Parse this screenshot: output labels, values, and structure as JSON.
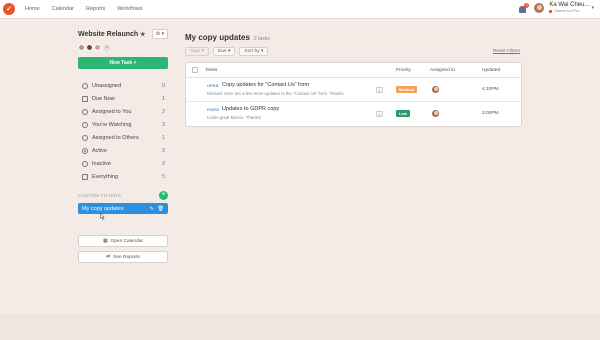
{
  "topbar": {
    "logo_glyph": "✓",
    "nav": [
      "Home",
      "Calendar",
      "Reports",
      "Workflows"
    ],
    "notification_count": "1",
    "user_name": "Ka Wai Cheu...",
    "user_role": "Owner for Pro...",
    "caret": "▾"
  },
  "sidebar": {
    "project_title": "Website Relaunch",
    "star": "★",
    "gear_label": "⚙ ▾",
    "add_member": "+",
    "new_task_label": "New Task +",
    "filters": [
      {
        "label": "Unassigned",
        "count": "0",
        "icon": "circle-outline-icon"
      },
      {
        "label": "Due Now",
        "count": "1",
        "icon": "calendar-icon"
      },
      {
        "label": "Assigned to You",
        "count": "2",
        "icon": "user-icon"
      },
      {
        "label": "You're Watching",
        "count": "3",
        "icon": "eye-icon"
      },
      {
        "label": "Assigned to Others",
        "count": "1",
        "icon": "users-icon"
      },
      {
        "label": "Active",
        "count": "3",
        "icon": "active-dot-icon"
      },
      {
        "label": "Inactive",
        "count": "2",
        "icon": "clock-icon"
      },
      {
        "label": "Everything",
        "count": "5",
        "icon": "stack-icon"
      }
    ],
    "custom_filters_label": "CUSTOM FILTERS",
    "custom_add": "+",
    "active_custom_filter": "My copy updates",
    "edit_glyph": "✎",
    "delete_glyph": "🗑",
    "open_calendar_label": "Open Calendar",
    "see_reports_label": "See Reports"
  },
  "main": {
    "title": "My copy updates",
    "subtitle": "2 tasks",
    "controls": {
      "tags": "Tags ▾",
      "due": "Due ▾",
      "sort": "Sort by ▾",
      "reset": "Reset Filters"
    },
    "columns": {
      "tasks": "Tasks",
      "priority": "Priority",
      "assigned": "Assigned to",
      "updated": "Updated"
    },
    "rows": [
      {
        "status": "OPEN",
        "name": "Copy updates for \"Contact Us\" form",
        "desc": "Michael: Here are a few more updates to the \"Contact Us\" form. Thanks",
        "comments": "1",
        "priority": "Medium",
        "priority_color": "#f5a25d",
        "updated": "4:10PM"
      },
      {
        "status": "FIXED",
        "name": "Updates to GDPR copy",
        "desc": "Looks great Marcie. Thanks!",
        "comments": "4",
        "priority": "Low",
        "priority_color": "#2a9d6a",
        "updated": "3:00PM"
      }
    ]
  },
  "colors": {
    "accent_green": "#2bb673",
    "accent_blue": "#2d8fdd",
    "brand_orange": "#e8542a"
  }
}
